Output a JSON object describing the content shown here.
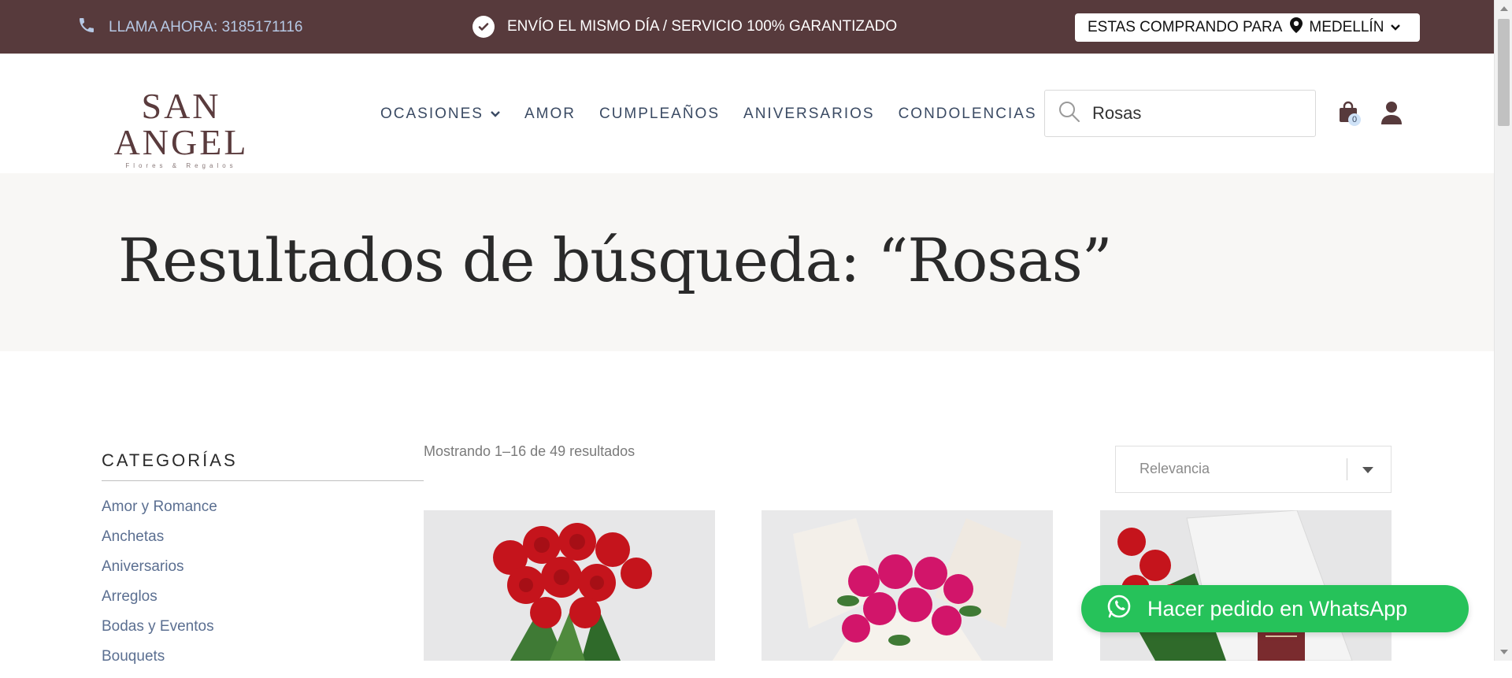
{
  "topbar": {
    "phone_text": "LLAMA AHORA: 3185171116",
    "promise_text": "ENVÍO EL MISMO DÍA / SERVICIO 100% GARANTIZADO",
    "city_prefix": "ESTAS COMPRANDO PARA",
    "city_name": "MEDELLÍN",
    "background_color": "#573a3c"
  },
  "header": {
    "logo_main": "SAN ANGEL",
    "logo_sub": "Flores & Regalos",
    "nav": [
      {
        "label": "OCASIONES",
        "has_dropdown": true
      },
      {
        "label": "AMOR"
      },
      {
        "label": "CUMPLEAÑOS"
      },
      {
        "label": "ANIVERSARIOS"
      },
      {
        "label": "CONDOLENCIAS"
      }
    ],
    "search_value": "Rosas",
    "cart_count": "0"
  },
  "hero": {
    "title": "Resultados de búsqueda: “Rosas”"
  },
  "sidebar": {
    "title": "CATEGORÍAS",
    "categories": [
      "Amor y Romance",
      "Anchetas",
      "Aniversarios",
      "Arreglos",
      "Bodas y Eventos",
      "Bouquets"
    ]
  },
  "results": {
    "count_text": "Mostrando 1–16 de 49 resultados",
    "sort_value": "Relevancia"
  },
  "products": [
    {
      "image": "red-roses-bouquet"
    },
    {
      "image": "pink-roses-bouquet"
    },
    {
      "image": "red-roses-gift-box"
    }
  ],
  "whatsapp": {
    "label": "Hacer pedido en WhatsApp",
    "color": "#26c25a"
  }
}
